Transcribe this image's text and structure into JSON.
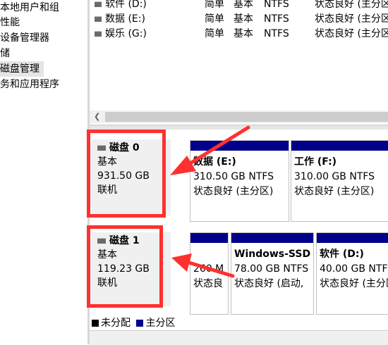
{
  "tree": {
    "items": [
      {
        "label": "本地用户和组"
      },
      {
        "label": "性能"
      },
      {
        "label": "设备管理器"
      },
      {
        "label": "储"
      },
      {
        "label": "磁盘管理"
      },
      {
        "label": "务和应用程序"
      }
    ]
  },
  "volumes": [
    {
      "name": "软件 (D:)",
      "layout": "简单",
      "type": "基本",
      "fs": "NTFS",
      "status": "状态良好 (主分区"
    },
    {
      "name": "数据 (E:)",
      "layout": "简单",
      "type": "基本",
      "fs": "NTFS",
      "status": "状态良好 (主分区"
    },
    {
      "name": "娱乐 (G:)",
      "layout": "简单",
      "type": "基本",
      "fs": "NTFS",
      "status": "状态良好 (主分区"
    }
  ],
  "disks": [
    {
      "name": "磁盘 0",
      "type": "基本",
      "size": "931.50 GB",
      "state": "联机",
      "partitions": [
        {
          "name": "数据  (E:)",
          "size": "310.50 GB NTFS",
          "status": "状态良好 (主分区)"
        },
        {
          "name": "工作  (F:)",
          "size": "310.00 GB NTFS",
          "status": "状态良好 (主分区)"
        }
      ]
    },
    {
      "name": "磁盘 1",
      "type": "基本",
      "size": "119.23 GB",
      "state": "联机",
      "partitions": [
        {
          "name": "",
          "size": "260 M",
          "status": "状态良"
        },
        {
          "name": "Windows-SSD",
          "size": "78.00 GB NTFS",
          "status": "状态良好 (启动,"
        },
        {
          "name": "软件  (D:)",
          "size": "40.00 GB NTFS",
          "status": "状态良好 (主分区"
        }
      ]
    }
  ],
  "legend": {
    "unallocated": "未分配",
    "primary": "主分区"
  },
  "colors": {
    "primary_partition": "#00008b",
    "unallocated": "#000000",
    "annotation": "#ff3030"
  }
}
